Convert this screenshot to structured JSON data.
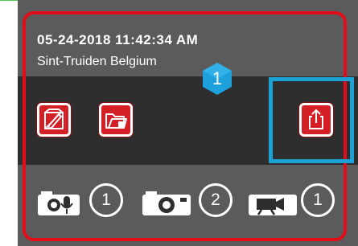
{
  "entry": {
    "datetime": "05-24-2018 11:42:34 AM",
    "location": "Sint-Truiden Belgium",
    "badge_count": "1"
  },
  "actions": {
    "edit_icon": "edit-document-icon",
    "folder_icon": "folder-icon",
    "share_icon": "share-export-icon"
  },
  "media": [
    {
      "icon": "camera-mic-icon",
      "count": "1"
    },
    {
      "icon": "camera-icon",
      "count": "2"
    },
    {
      "icon": "video-camera-icon",
      "count": "1"
    }
  ],
  "colors": {
    "card_border": "#e30d19",
    "highlight": "#1da2d6",
    "button_red": "#d41f26",
    "badge_blue": "#1ea0dc"
  }
}
